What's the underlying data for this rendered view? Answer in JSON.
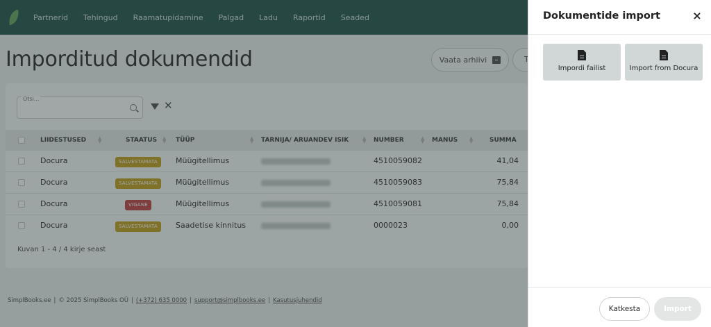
{
  "nav": {
    "items": [
      "Partnerid",
      "Tehingud",
      "Raamatupidamine",
      "Palgad",
      "Ladu",
      "Raportid",
      "Seaded"
    ]
  },
  "page": {
    "title": "Imporditud dokumendid",
    "archive_button": "Vaata arhiivi",
    "next_button": "T"
  },
  "search": {
    "label": "Otsi..."
  },
  "table": {
    "headers": [
      "LIIDESTUSED",
      "STAATUS",
      "TÜÜP",
      "TARNIJA/ ARUANDEV ISIK",
      "NUMBER",
      "MANUS",
      "SUMMA"
    ],
    "rows": [
      {
        "integration": "Docura",
        "status": "SALVESTAMATA",
        "status_kind": "warn",
        "type": "Müügitellimus",
        "number": "4510059082",
        "amount": "41,04"
      },
      {
        "integration": "Docura",
        "status": "SALVESTAMATA",
        "status_kind": "warn",
        "type": "Müügitellimus",
        "number": "4510059083",
        "amount": "75,84"
      },
      {
        "integration": "Docura",
        "status": "VIGANE",
        "status_kind": "bad",
        "type": "Müügitellimus",
        "number": "4510059081",
        "amount": "75,84"
      },
      {
        "integration": "Docura",
        "status": "SALVESTAMATA",
        "status_kind": "warn",
        "type": "Saadetise kinnitus",
        "number": "0000023",
        "amount": "0,00"
      }
    ],
    "pager": "Kuvan 1 - 4 / 4 kirje seast"
  },
  "footer": {
    "brand": "SimplBooks.ee",
    "copyright": "© 2025 SimplBooks OÜ",
    "phone": "(+372) 635 0000",
    "email": "support@simplbooks.ee",
    "guide": "Kasutusjuhendid"
  },
  "panel": {
    "title": "Dokumentide import",
    "close": "×",
    "options": [
      {
        "label": "Impordi failist",
        "icon": "file-icon"
      },
      {
        "label": "Import from Docura",
        "icon": "file-icon"
      }
    ],
    "cancel": "Katkesta",
    "import": "Import"
  },
  "colors": {
    "nav_bg": "#2f5b55",
    "badge_warn": "#c9a227",
    "badge_bad": "#c34a4a",
    "import_option_bg": "#d1d6d6"
  }
}
